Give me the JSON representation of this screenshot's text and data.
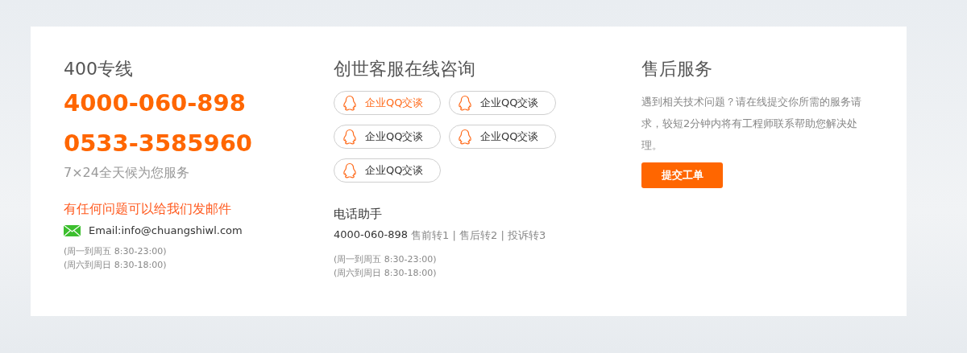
{
  "hotline": {
    "title": "400专线",
    "numbers": [
      "4000-060-898",
      "0533-3585960"
    ],
    "note": "7×24全天候为您服务",
    "email_heading": "有任何问题可以给我们发邮件",
    "email": "Email:info@chuangshiwl.com",
    "hours": [
      "(周一到周五 8:30-23:00)",
      "(周六到周日 8:30-18:00)"
    ]
  },
  "online": {
    "title": "创世客服在线咨询",
    "qq_buttons": [
      {
        "label": "企业QQ交谈",
        "selected": true
      },
      {
        "label": "企业QQ交谈",
        "selected": false
      },
      {
        "label": "企业QQ交谈",
        "selected": false
      },
      {
        "label": "企业QQ交谈",
        "selected": false
      },
      {
        "label": "企业QQ交谈",
        "selected": false
      }
    ],
    "phone_title": "电话助手",
    "phone_number": "4000-060-898",
    "phone_menu": "售前转1 | 售后转2 | 投诉转3",
    "hours": [
      "(周一到周五 8:30-23:00)",
      "(周六到周日 8:30-18:00)"
    ]
  },
  "after_sales": {
    "title": "售后服务",
    "description": "遇到相关技术问题？请在线提交你所需的服务请求，较短2分钟内将有工程师联系帮助您解决处理。",
    "button": "提交工单"
  }
}
